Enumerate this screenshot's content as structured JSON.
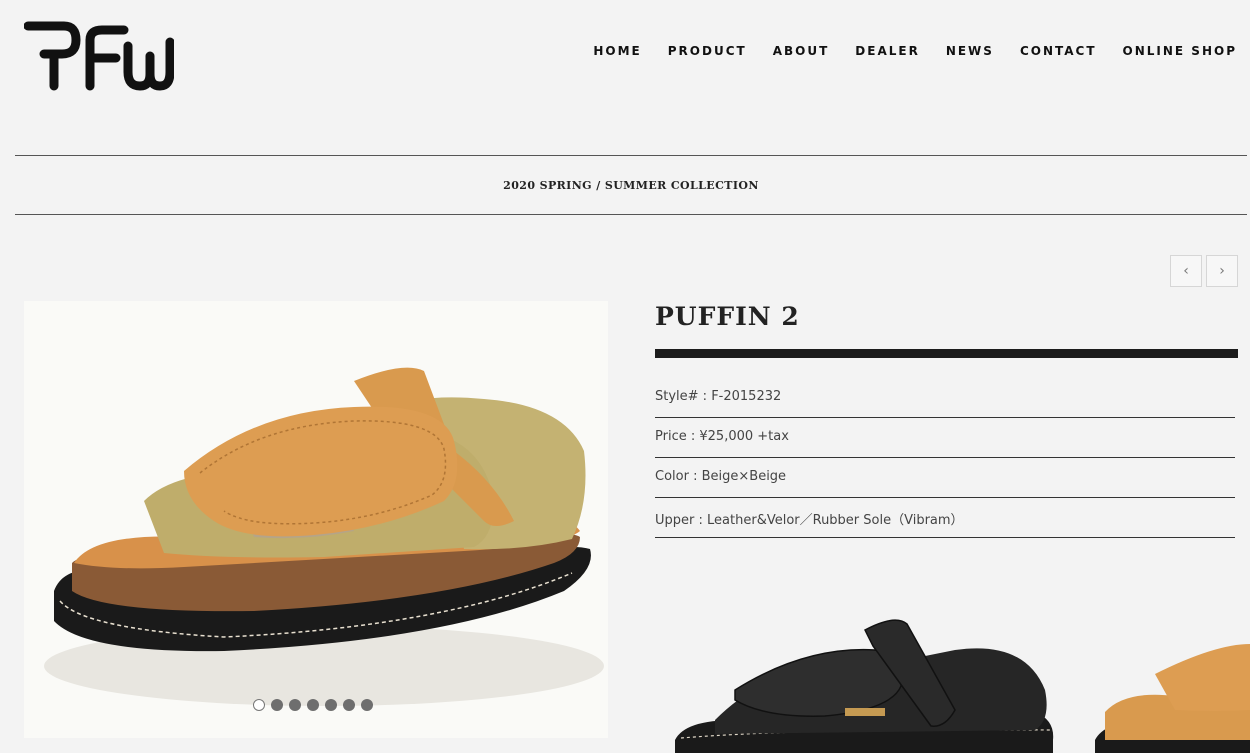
{
  "brand": {
    "logo_text": "RFW"
  },
  "nav": {
    "items": [
      "HOME",
      "PRODUCT",
      "ABOUT",
      "DEALER",
      "NEWS",
      "CONTACT",
      "ONLINE SHOP"
    ]
  },
  "collection": {
    "title": "2020 SPRING / SUMMER COLLECTION"
  },
  "pager": {
    "prev": "‹",
    "next": "›"
  },
  "product": {
    "name": "PUFFIN 2",
    "specs": [
      {
        "label": "Style#",
        "value": "F-2015232"
      },
      {
        "label": "Price",
        "value": "¥25,000 +tax"
      },
      {
        "label": "Color",
        "value": "Beige×Beige"
      },
      {
        "label": "Upper",
        "value": "Leather&Velor／Rubber Sole（Vibram）"
      }
    ]
  },
  "gallery": {
    "total_slides": 7,
    "active_slide": 1
  },
  "colors": {
    "background": "#f3f3f3",
    "text": "#222222",
    "accent_bar": "#1c1c1c",
    "strap_tan": "#d99a4e",
    "suede_beige": "#c4b272",
    "sole_black": "#1a1a1a"
  }
}
